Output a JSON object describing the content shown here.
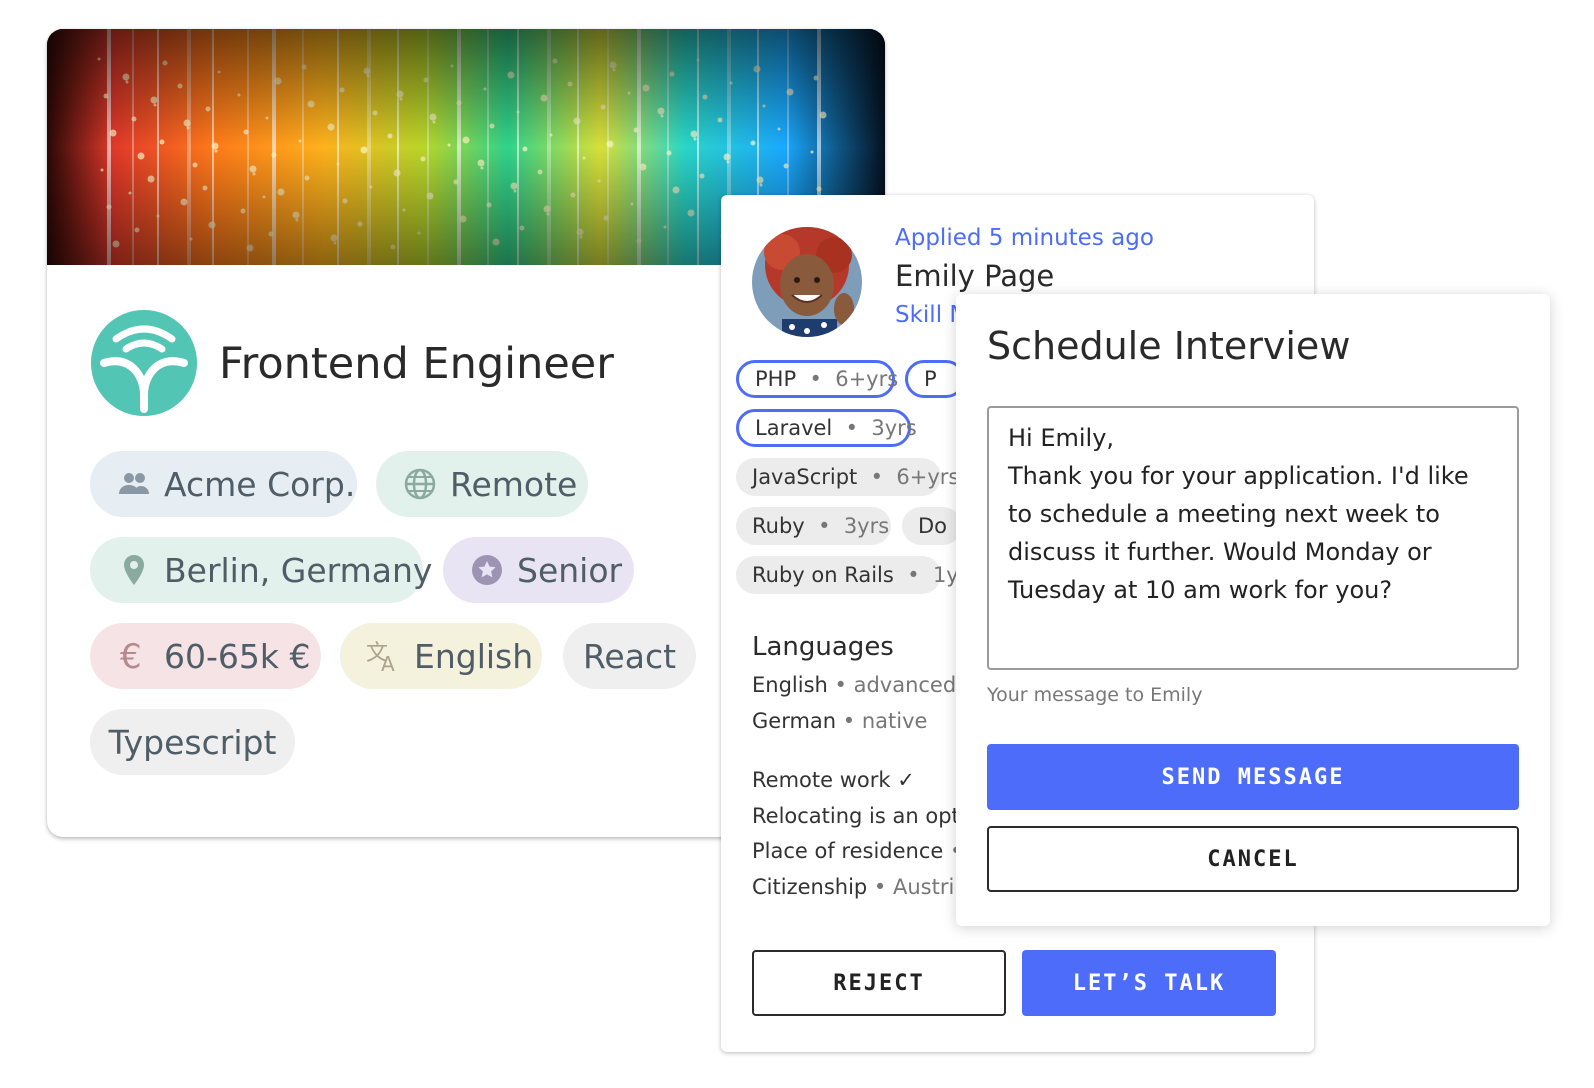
{
  "job": {
    "title": "Frontend Engineer",
    "logo_icon": "sprout-logo-icon",
    "chips": [
      {
        "label": "Acme Corp.",
        "icon": "people-icon",
        "bg": "#e6edf3"
      },
      {
        "label": "Remote",
        "icon": "globe-icon",
        "bg": "#e3f1ec"
      },
      {
        "label": "Berlin, Germany",
        "icon": "location-pin-icon",
        "bg": "#e3f1ec"
      },
      {
        "label": "Senior",
        "icon": "star-badge-icon",
        "bg": "#e9e4f3"
      },
      {
        "label": "60-65k €",
        "icon": "euro-icon",
        "bg": "#f6e3e5"
      },
      {
        "label": "English",
        "icon": "translate-icon",
        "bg": "#f4f1dd"
      },
      {
        "label": "React",
        "icon": "",
        "bg": "#efefef"
      },
      {
        "label": "Typescript",
        "icon": "",
        "bg": "#efefef"
      }
    ]
  },
  "applicant": {
    "applied": "Applied 5 minutes ago",
    "name": "Emily Page",
    "skill_link": "Skill M",
    "skills": [
      {
        "name": "PHP",
        "level": "6+yrs",
        "style": "outlined"
      },
      {
        "name": "P",
        "level": "",
        "style": "outlined"
      },
      {
        "name": "Laravel",
        "level": "3yrs",
        "style": "outlined"
      },
      {
        "name": "JavaScript",
        "level": "6+yrs",
        "style": "filled"
      },
      {
        "name": "Ruby",
        "level": "3yrs",
        "style": "filled"
      },
      {
        "name": "Do",
        "level": "",
        "style": "filled"
      },
      {
        "name": "Ruby on Rails",
        "level": "1y",
        "style": "filled"
      }
    ],
    "languages_title": "Languages",
    "languages": [
      {
        "name": "English",
        "level": "advanced"
      },
      {
        "name": "German",
        "level": "native"
      }
    ],
    "details": [
      {
        "label": "Remote work ✓",
        "value": ""
      },
      {
        "label": "Relocating is an opti",
        "value": ""
      },
      {
        "label": "Place of residence",
        "value": ""
      },
      {
        "label": "Citizenship",
        "value": "Austri"
      }
    ],
    "reject_label": "REJECT",
    "talk_label": "LET’S TALK"
  },
  "modal": {
    "title": "Schedule Interview",
    "message": "Hi Emily,\nThank you for your application. I'd like to schedule a meeting next week to discuss it further. Would Monday or Tuesday at 10 am work for you?",
    "helper": "Your message to Emily",
    "send_label": "SEND MESSAGE",
    "cancel_label": "CANCEL"
  },
  "colors": {
    "accent": "#4d6cfa",
    "logo": "#4dbfae"
  }
}
